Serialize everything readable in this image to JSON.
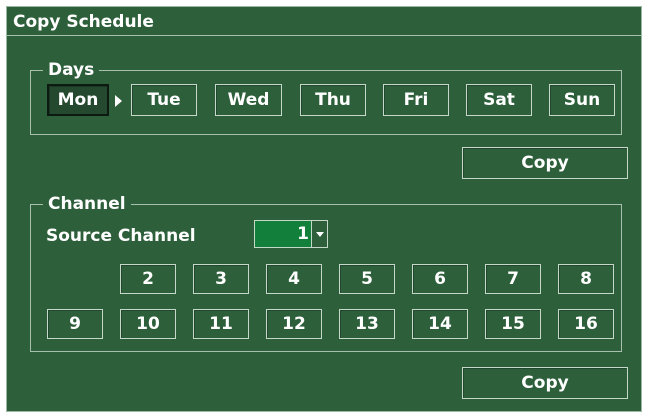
{
  "window": {
    "title": "Copy Schedule"
  },
  "days_group": {
    "label": "Days",
    "selected": "Mon",
    "days": [
      "Mon",
      "Tue",
      "Wed",
      "Thu",
      "Fri",
      "Sat",
      "Sun"
    ],
    "copy_label": "Copy"
  },
  "channel_group": {
    "label": "Channel",
    "source_label": "Source Channel",
    "source_value": "1",
    "row1": [
      "2",
      "3",
      "4",
      "5",
      "6",
      "7",
      "8"
    ],
    "row2": [
      "9",
      "10",
      "11",
      "12",
      "13",
      "14",
      "15",
      "16"
    ],
    "copy_label": "Copy"
  },
  "colors": {
    "background": "#2d5f3b",
    "selected_field": "#12803a",
    "text": "#ffffff"
  },
  "icons": {
    "selection_arrow": "triangle-right-icon",
    "dropdown": "chevron-down-icon"
  }
}
